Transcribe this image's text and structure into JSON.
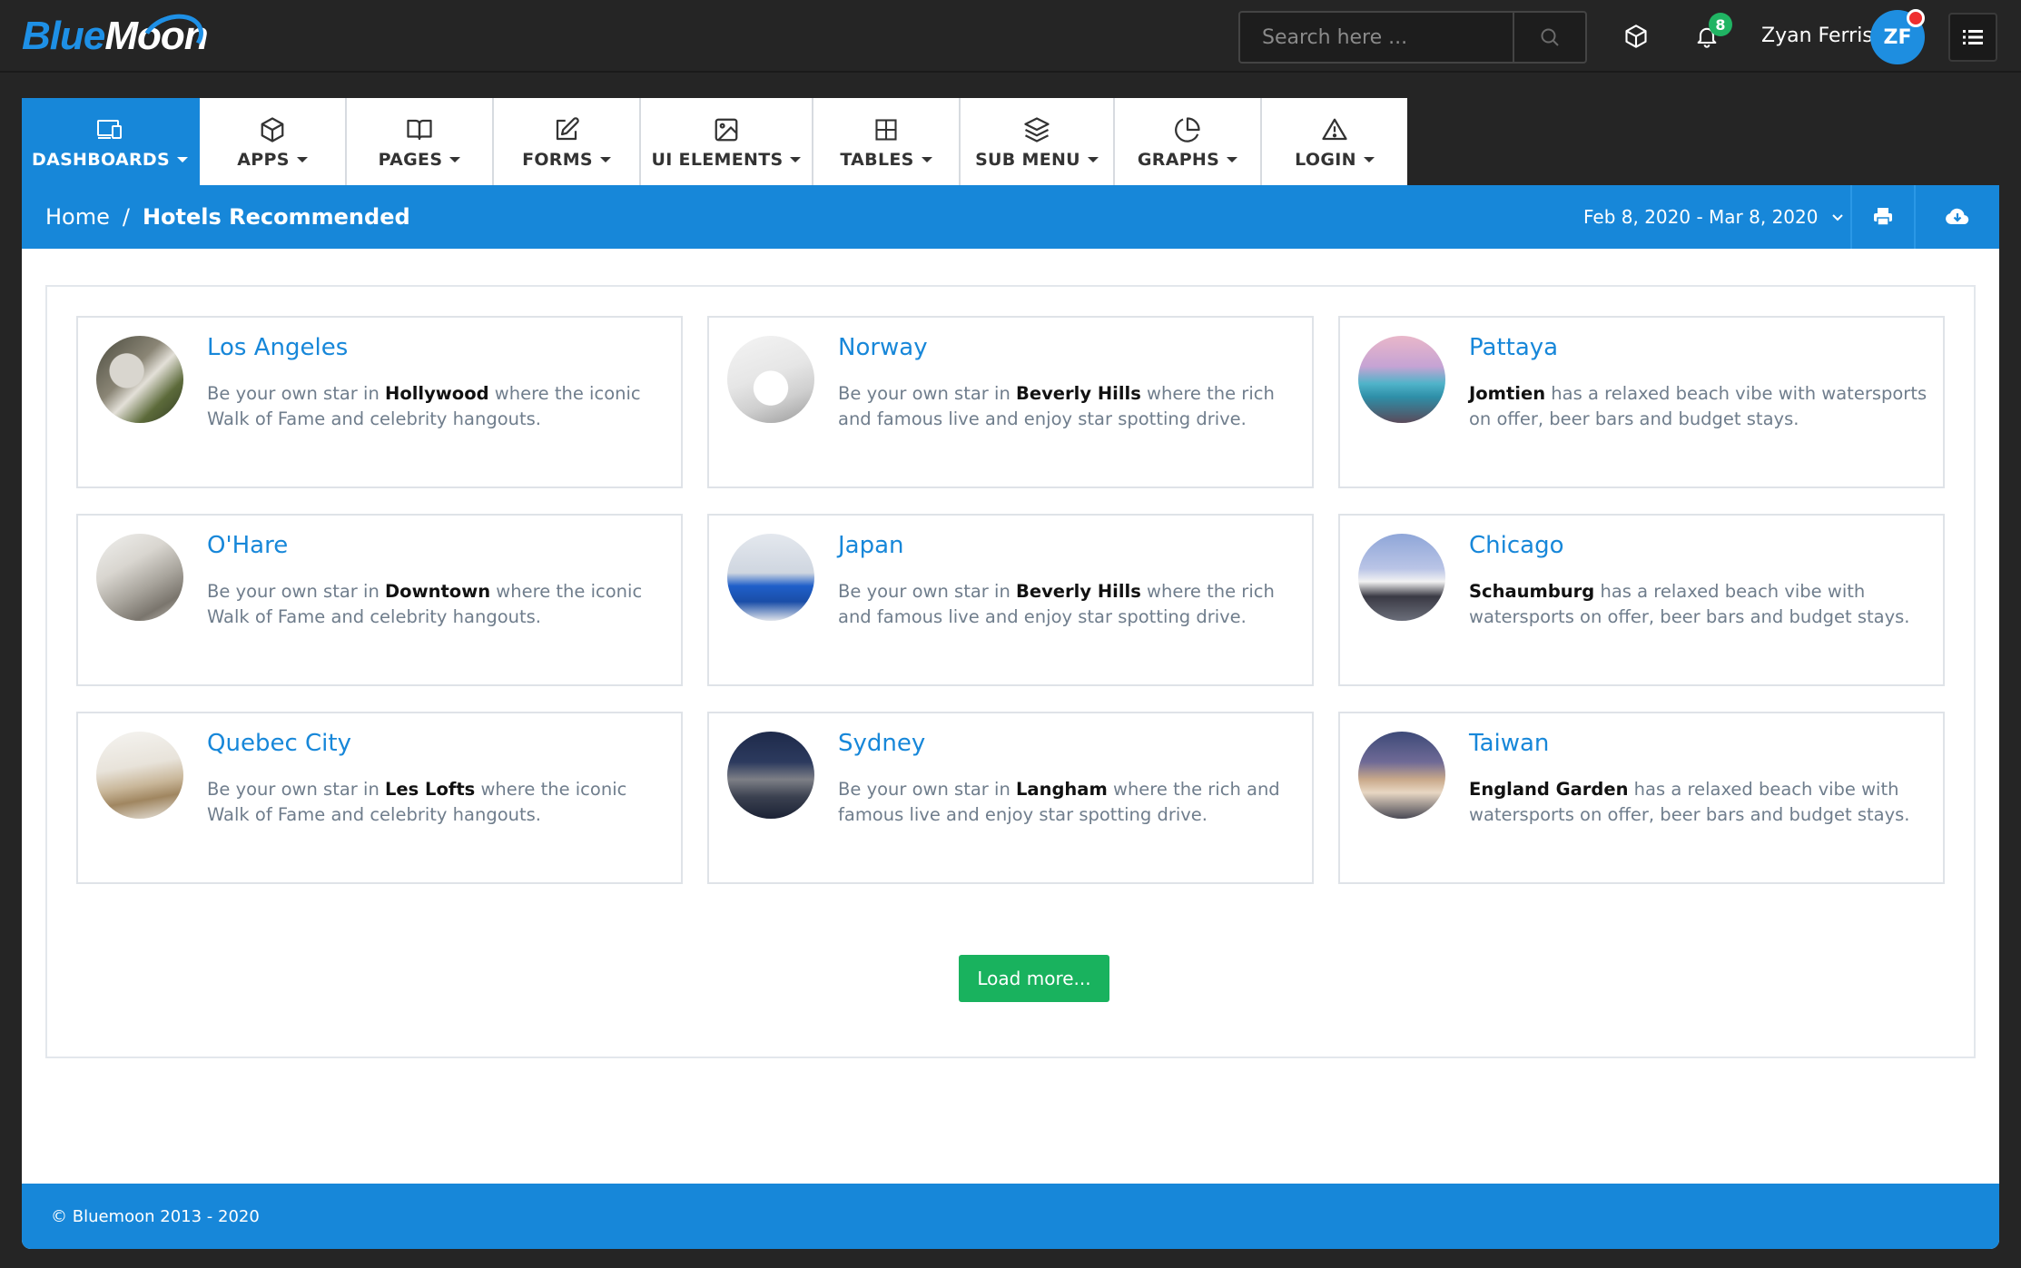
{
  "header": {
    "logo_blue": "Blue",
    "logo_white": "Moon",
    "search_placeholder": "Search here ...",
    "notification_count": "8",
    "username": "Zyan Ferris",
    "avatar_initials": "ZF"
  },
  "nav": {
    "tabs": [
      {
        "label": "DASHBOARDS",
        "icon": "devices-icon",
        "active": true
      },
      {
        "label": "APPS",
        "icon": "box-icon"
      },
      {
        "label": "PAGES",
        "icon": "book-icon"
      },
      {
        "label": "FORMS",
        "icon": "edit-icon"
      },
      {
        "label": "UI ELEMENTS",
        "icon": "image-icon"
      },
      {
        "label": "TABLES",
        "icon": "grid-icon"
      },
      {
        "label": "SUB MENU",
        "icon": "layers-icon"
      },
      {
        "label": "GRAPHS",
        "icon": "pie-chart-icon"
      },
      {
        "label": "LOGIN",
        "icon": "alert-triangle-icon"
      }
    ]
  },
  "breadcrumb": {
    "home": "Home",
    "separator": "/",
    "current": "Hotels Recommended"
  },
  "date_range": "Feb 8, 2020 - Mar 8, 2020",
  "cards": [
    {
      "title": "Los Angeles",
      "pre": "Be your own star in ",
      "bold": "Hollywood",
      "post": " where the iconic Walk of Fame and celebrity hangouts."
    },
    {
      "title": "Norway",
      "pre": "Be your own star in ",
      "bold": "Beverly Hills",
      "post": " where the rich and famous live and enjoy star spotting drive."
    },
    {
      "title": "Pattaya",
      "pre": "",
      "bold": "Jomtien",
      "post": " has a relaxed beach vibe with watersports on offer, beer bars and budget stays."
    },
    {
      "title": "O'Hare",
      "pre": "Be your own star in ",
      "bold": "Downtown",
      "post": " where the iconic Walk of Fame and celebrity hangouts."
    },
    {
      "title": "Japan",
      "pre": "Be your own star in ",
      "bold": "Beverly Hills",
      "post": " where the rich and famous live and enjoy star spotting drive."
    },
    {
      "title": "Chicago",
      "pre": "",
      "bold": "Schaumburg",
      "post": " has a relaxed beach vibe with watersports on offer, beer bars and budget stays."
    },
    {
      "title": "Quebec City",
      "pre": "Be your own star in ",
      "bold": "Les Lofts",
      "post": " where the iconic Walk of Fame and celebrity hangouts."
    },
    {
      "title": "Sydney",
      "pre": "Be your own star in ",
      "bold": "Langham",
      "post": " where the rich and famous live and enjoy star spotting drive."
    },
    {
      "title": "Taiwan",
      "pre": "",
      "bold": "England Garden",
      "post": " has a relaxed beach vibe with watersports on offer, beer bars and budget stays."
    }
  ],
  "load_more_label": "Load more...",
  "footer_text": "© Bluemoon 2013 - 2020",
  "colors": {
    "accent": "#1787d9",
    "success": "#19b25e",
    "badge": "#20b463",
    "dark_bg": "#252525"
  }
}
